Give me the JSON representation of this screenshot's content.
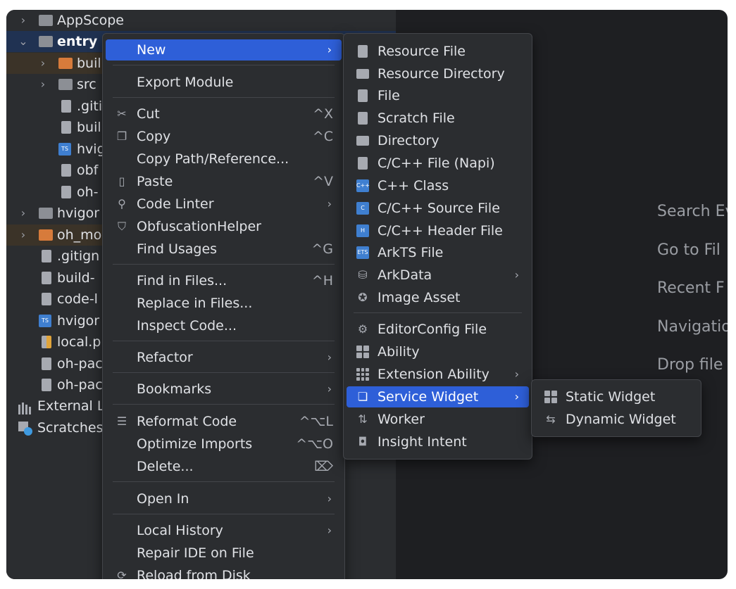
{
  "tree": {
    "rows": [
      {
        "arrow": ">",
        "label": "AppScope"
      },
      {
        "arrow": "v",
        "label": "entry"
      },
      {
        "arrow": ">",
        "label": "buil"
      },
      {
        "arrow": ">",
        "label": "src"
      },
      {
        "arrow": "",
        "label": ".giti"
      },
      {
        "arrow": "",
        "label": "buil"
      },
      {
        "arrow": "",
        "label": "hvig"
      },
      {
        "arrow": "",
        "label": "obf"
      },
      {
        "arrow": "",
        "label": "oh-"
      },
      {
        "arrow": ">",
        "label": "hvigor"
      },
      {
        "arrow": ">",
        "label": "oh_mo"
      },
      {
        "arrow": "",
        "label": ".gitign"
      },
      {
        "arrow": "",
        "label": "build-"
      },
      {
        "arrow": "",
        "label": "code-l"
      },
      {
        "arrow": "",
        "label": "hvigor"
      },
      {
        "arrow": "",
        "label": "local.p"
      },
      {
        "arrow": "",
        "label": "oh-pac"
      },
      {
        "arrow": "",
        "label": "oh-pac"
      },
      {
        "arrow": "",
        "label": "External L"
      },
      {
        "arrow": "",
        "label": "Scratches"
      }
    ]
  },
  "editor_hints": [
    "Search Ev",
    "Go to Fil",
    "Recent F",
    "Navigatio",
    "Drop file"
  ],
  "context_menu": {
    "new": "New",
    "export_module": "Export Module",
    "cut": "Cut",
    "cut_sc": "^X",
    "copy": "Copy",
    "copy_sc": "^C",
    "copy_path": "Copy Path/Reference...",
    "paste": "Paste",
    "paste_sc": "^V",
    "code_linter": "Code Linter",
    "obfuscation": "ObfuscationHelper",
    "find_usages": "Find Usages",
    "find_usages_sc": "^G",
    "find_in_files": "Find in Files...",
    "find_in_files_sc": "^H",
    "replace_in_files": "Replace in Files...",
    "inspect_code": "Inspect Code...",
    "refactor": "Refactor",
    "bookmarks": "Bookmarks",
    "reformat_code": "Reformat Code",
    "reformat_code_sc": "^⌥L",
    "optimize_imports": "Optimize Imports",
    "optimize_imports_sc": "^⌥O",
    "delete": "Delete...",
    "open_in": "Open In",
    "local_history": "Local History",
    "repair_ide": "Repair IDE on File",
    "reload_from_disk": "Reload from Disk"
  },
  "new_submenu": {
    "resource_file": "Resource File",
    "resource_directory": "Resource Directory",
    "file": "File",
    "scratch_file": "Scratch File",
    "directory": "Directory",
    "cpp_file_napi": "C/C++ File (Napi)",
    "cpp_class": "C++ Class",
    "cpp_source": "C/C++ Source File",
    "cpp_header": "C/C++ Header File",
    "arkts_file": "ArkTS File",
    "arkdata": "ArkData",
    "image_asset": "Image Asset",
    "editorconfig": "EditorConfig File",
    "ability": "Ability",
    "extension_ability": "Extension Ability",
    "service_widget": "Service Widget",
    "worker": "Worker",
    "insight_intent": "Insight Intent"
  },
  "widget_submenu": {
    "static_widget": "Static Widget",
    "dynamic_widget": "Dynamic Widget"
  },
  "colors": {
    "accent": "#2e5fd8",
    "tree_selected": "#203252",
    "folder_orange": "#d77b3b"
  }
}
